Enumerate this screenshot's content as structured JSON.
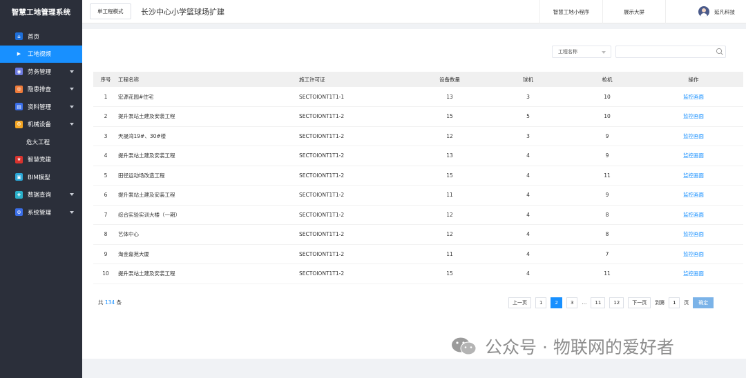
{
  "app": {
    "title": "智慧工地管理系统"
  },
  "sidebar": {
    "items": [
      {
        "label": "首页",
        "icon": "home-icon",
        "color": "#1e6fd9",
        "glyph": "⌂",
        "expandable": false,
        "active": false
      },
      {
        "label": "工地视频",
        "icon": "video-icon",
        "color": "#1890ff",
        "glyph": "▶",
        "expandable": false,
        "active": true
      },
      {
        "label": "劳务管理",
        "icon": "labor-icon",
        "color": "#6c7ae0",
        "glyph": "◉",
        "expandable": true,
        "active": false
      },
      {
        "label": "隐患排查",
        "icon": "hazard-icon",
        "color": "#f07c3a",
        "glyph": "◎",
        "expandable": true,
        "active": false
      },
      {
        "label": "资料管理",
        "icon": "document-icon",
        "color": "#3a6ee8",
        "glyph": "▤",
        "expandable": true,
        "active": false
      },
      {
        "label": "机械设备",
        "icon": "machine-icon",
        "color": "#f5a623",
        "glyph": "⚙",
        "expandable": true,
        "active": false
      },
      {
        "label": "危大工程",
        "icon": "",
        "color": "",
        "glyph": "",
        "expandable": false,
        "active": false
      },
      {
        "label": "智慧党建",
        "icon": "party-icon",
        "color": "#d9332e",
        "glyph": "★",
        "expandable": false,
        "active": false
      },
      {
        "label": "BIM模型",
        "icon": "bim-icon",
        "color": "#2aa6d6",
        "glyph": "▣",
        "expandable": false,
        "active": false
      },
      {
        "label": "数据查询",
        "icon": "data-icon",
        "color": "#2ab0c9",
        "glyph": "◈",
        "expandable": true,
        "active": false
      },
      {
        "label": "系统管理",
        "icon": "settings-icon",
        "color": "#3a6ee8",
        "glyph": "⚙",
        "expandable": true,
        "active": false
      }
    ]
  },
  "header": {
    "mode_button": "单工程模式",
    "project_title": "长沙中心小学篮球场扩建",
    "mini_program": "智慧工地小程序",
    "big_screen": "展示大屏",
    "user_name": "延凡科技"
  },
  "filter": {
    "select_value": "工程名称",
    "search_value": ""
  },
  "table": {
    "headers": [
      "序号",
      "工程名称",
      "施工许可证",
      "设备数量",
      "球机",
      "枪机",
      "操作"
    ],
    "rows": [
      [
        "1",
        "宏源花园#住宅",
        "SECTOIONT1T1-1",
        "13",
        "3",
        "10",
        "监控画面"
      ],
      [
        "2",
        "提升泵站土建及安装工程",
        "SECTOIONT1T1-2",
        "15",
        "5",
        "10",
        "监控画面"
      ],
      [
        "3",
        "天晟湾19#、30#楼",
        "SECTOIONT1T1-2",
        "12",
        "3",
        "9",
        "监控画面"
      ],
      [
        "4",
        "提升泵站土建及安装工程",
        "SECTOIONT1T1-2",
        "13",
        "4",
        "9",
        "监控画面"
      ],
      [
        "5",
        "田径运动场改造工程",
        "SECTOIONT1T1-2",
        "15",
        "4",
        "11",
        "监控画面"
      ],
      [
        "6",
        "提升泵站土建及安装工程",
        "SECTOIONT1T1-2",
        "11",
        "4",
        "9",
        "监控画面"
      ],
      [
        "7",
        "综合实验实训大楼（一期）",
        "SECTOIONT1T1-2",
        "12",
        "4",
        "8",
        "监控画面"
      ],
      [
        "8",
        "艺体中心",
        "SECTOIONT1T1-2",
        "12",
        "4",
        "8",
        "监控画面"
      ],
      [
        "9",
        "淘金嘉苑大厦",
        "SECTOIONT1T1-2",
        "11",
        "4",
        "7",
        "监控画面"
      ],
      [
        "10",
        "提升泵站土建及安装工程",
        "SECTOIONT1T1-2",
        "15",
        "4",
        "11",
        "监控画面"
      ]
    ]
  },
  "pagination": {
    "total_prefix": "共",
    "total": "134",
    "total_suffix": "条",
    "prev": "上一页",
    "pages": [
      "1",
      "2",
      "3",
      "…",
      "11",
      "12"
    ],
    "current": "2",
    "next": "下一页",
    "goto_label": "到第",
    "goto_value": "1",
    "page_unit": "页",
    "confirm": "确定"
  },
  "watermark": {
    "text": "公众号 · 物联网的爱好者"
  },
  "colors": {
    "sidebar_bg": "#2b2f3a",
    "accent": "#1890ff",
    "page_bg": "#f0f2f5"
  }
}
